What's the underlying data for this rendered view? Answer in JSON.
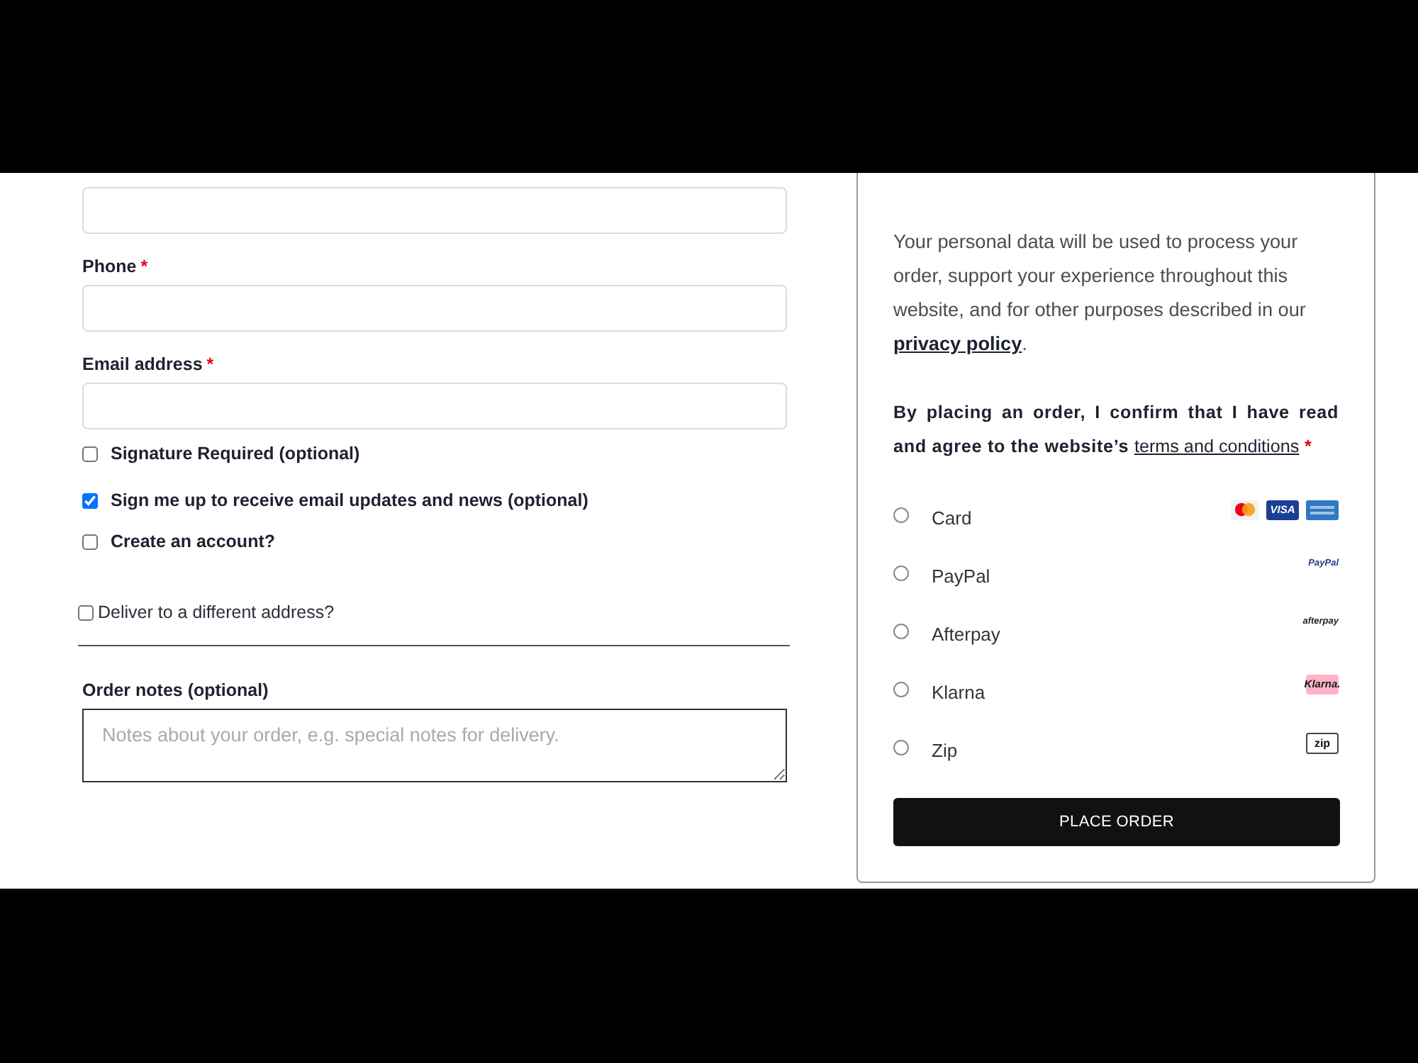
{
  "billing_fields": [
    {
      "kind": "input"
    },
    {
      "kind": "input",
      "label": "Phone",
      "required_mark": "*"
    },
    {
      "kind": "input",
      "label": "Email address",
      "required_mark": "*"
    }
  ],
  "options": [
    {
      "label": "Signature Required (optional)",
      "checked": false
    },
    {
      "label": "Sign me up to receive email updates and news (optional)",
      "checked": true
    },
    {
      "label": "Create an account?",
      "checked": false
    }
  ],
  "ship_to_different": {
    "label": "Deliver to a different address?",
    "checked": false
  },
  "order_notes": {
    "label": "Order notes (optional)",
    "placeholder": "Notes about your order, e.g. special notes for delivery."
  },
  "privacy": {
    "text": "Your personal data will be used to process your order, support your experience throughout this website, and for other purposes described in our",
    "link": "privacy policy",
    "after": "."
  },
  "terms": {
    "text": "By placing an order, I confirm that I have read and agree to the website’s",
    "link": "terms and conditions",
    "required_mark": "*"
  },
  "payment_methods": [
    {
      "label": "Card",
      "selected": false,
      "logos": [
        {
          "kind": "circles"
        },
        {
          "kind": "tile",
          "text": "VISA",
          "color": "#1a3f93"
        },
        {
          "kind": "tile",
          "color": "#2f78c4"
        }
      ]
    },
    {
      "label": "PayPal",
      "selected": false,
      "logos": [
        {
          "kind": "wordmark",
          "text": "PayPal",
          "color": "#253b80"
        }
      ]
    },
    {
      "label": "Afterpay",
      "selected": false,
      "logos": [
        {
          "kind": "wordmark",
          "text": "afterpay",
          "color": "#222222"
        }
      ]
    },
    {
      "label": "Klarna",
      "selected": false,
      "logos": [
        {
          "kind": "tile",
          "text": "Klarna.",
          "color": "#ffb3c7"
        }
      ]
    },
    {
      "label": "Zip",
      "selected": false,
      "logos": [
        {
          "kind": "outline",
          "text": "zip"
        }
      ]
    }
  ],
  "place_order": "PLACE ORDER"
}
